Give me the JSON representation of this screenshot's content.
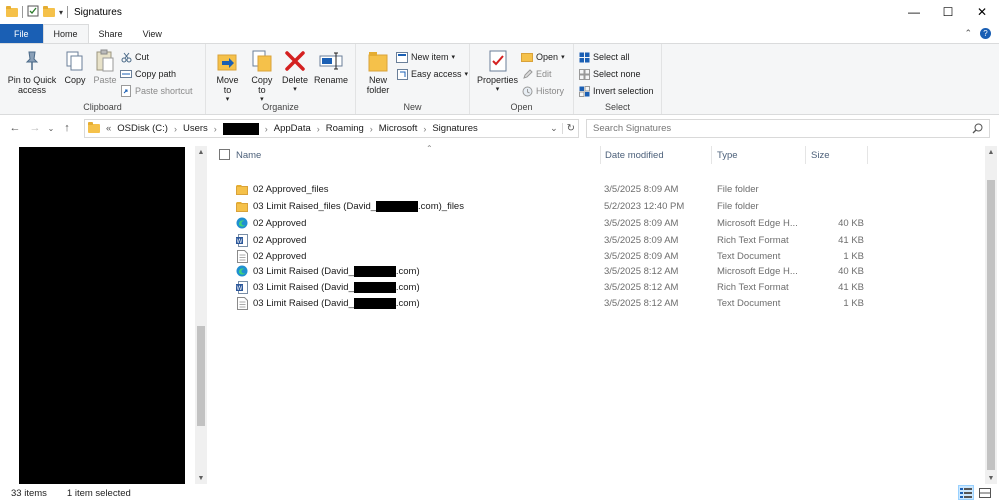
{
  "window": {
    "title": "Signatures",
    "controls": {
      "minimize": "—",
      "maximize": "☐",
      "close": "✕"
    }
  },
  "ribbon_tabs": [
    "File",
    "Home",
    "Share",
    "View"
  ],
  "ribbon": {
    "clipboard": {
      "label": "Clipboard",
      "pin": "Pin to Quick access",
      "copy": "Copy",
      "paste": "Paste",
      "cut": "Cut",
      "copy_path": "Copy path",
      "paste_shortcut": "Paste shortcut"
    },
    "organize": {
      "label": "Organize",
      "move_to": "Move to",
      "copy_to": "Copy to",
      "delete": "Delete",
      "rename": "Rename"
    },
    "new": {
      "label": "New",
      "new_folder": "New folder",
      "new_item": "New item",
      "easy_access": "Easy access"
    },
    "open": {
      "label": "Open",
      "properties": "Properties",
      "open": "Open",
      "edit": "Edit",
      "history": "History"
    },
    "select": {
      "label": "Select",
      "select_all": "Select all",
      "select_none": "Select none",
      "invert_selection": "Invert selection"
    }
  },
  "address": {
    "overflow": "«",
    "crumbs": [
      "OSDisk (C:)",
      "Users",
      "",
      "AppData",
      "Roaming",
      "Microsoft",
      "Signatures"
    ]
  },
  "search": {
    "placeholder": "Search Signatures"
  },
  "columns": {
    "name": "Name",
    "date": "Date modified",
    "type": "Type",
    "size": "Size"
  },
  "files": [
    {
      "prefix": "02 Approved_files",
      "suffix": "",
      "redacted": false,
      "date": "3/5/2025 8:09 AM",
      "type": "File folder",
      "size": "",
      "icon": "folder-icon"
    },
    {
      "prefix": "03 Limit Raised_files (David_",
      "suffix": ".com)_files",
      "redacted": true,
      "date": "5/2/2023 12:40 PM",
      "type": "File folder",
      "size": "",
      "icon": "folder-icon"
    },
    {
      "prefix": "02 Approved",
      "suffix": "",
      "redacted": false,
      "date": "3/5/2025 8:09 AM",
      "type": "Microsoft Edge H...",
      "size": "40 KB",
      "icon": "edge-icon"
    },
    {
      "prefix": "02 Approved",
      "suffix": "",
      "redacted": false,
      "date": "3/5/2025 8:09 AM",
      "type": "Rich Text Format",
      "size": "41 KB",
      "icon": "word-icon"
    },
    {
      "prefix": "02 Approved",
      "suffix": "",
      "redacted": false,
      "date": "3/5/2025 8:09 AM",
      "type": "Text Document",
      "size": "1 KB",
      "icon": "text-document-icon"
    },
    {
      "prefix": "03 Limit Raised (David_",
      "suffix": ".com)",
      "redacted": true,
      "date": "3/5/2025 8:12 AM",
      "type": "Microsoft Edge H...",
      "size": "40 KB",
      "icon": "edge-icon"
    },
    {
      "prefix": "03 Limit Raised (David_",
      "suffix": ".com)",
      "redacted": true,
      "date": "3/5/2025 8:12 AM",
      "type": "Rich Text Format",
      "size": "41 KB",
      "icon": "word-icon"
    },
    {
      "prefix": "03 Limit Raised (David_",
      "suffix": ".com)",
      "redacted": true,
      "date": "3/5/2025 8:12 AM",
      "type": "Text Document",
      "size": "1 KB",
      "icon": "text-document-icon"
    }
  ],
  "status": {
    "items": "33 items",
    "selected": "1 item selected"
  },
  "colors": {
    "accent": "#1a5fb4",
    "folder": "#f5c14a",
    "ribbon_bg": "#f5f6f7"
  }
}
